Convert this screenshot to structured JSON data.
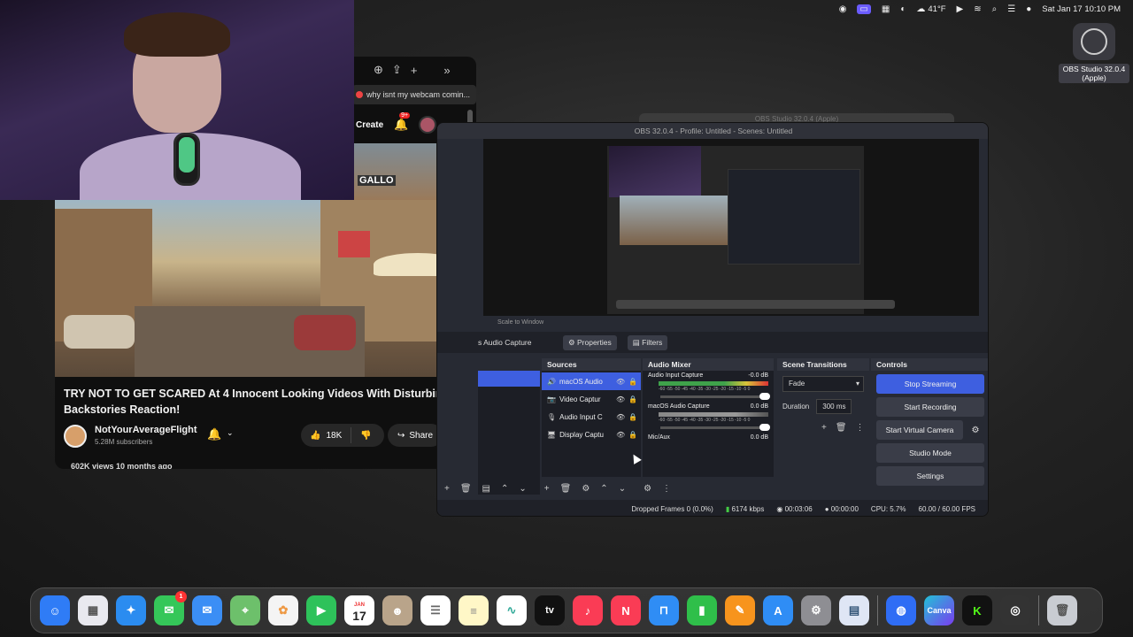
{
  "menubar": {
    "weather": "41°F",
    "clock": "Sat Jan 17  10:10 PM",
    "icons": [
      "stop-record-icon",
      "screen-mirror-icon",
      "gallery-icon",
      "creative-cloud-icon",
      "weather-icon",
      "play-icon",
      "wifi-icon",
      "search-icon",
      "control-center-icon",
      "siri-icon"
    ]
  },
  "desktop_icon": {
    "label": "OBS Studio 32.0.4 (Apple)"
  },
  "browser": {
    "tab_title": "why isnt my webcam comin...",
    "create_label": "Create",
    "notif_count": "9+",
    "overlay_text": "GALLO",
    "video_title": "TRY NOT TO GET SCARED At 4 Innocent Looking Videos With Disturbing Backstories Reaction!",
    "channel_name": "NotYourAverageFlight",
    "subscribers": "5.28M subscribers",
    "likes": "18K",
    "share_label": "Share",
    "views": "602K views  10 months ago"
  },
  "obs": {
    "back_title": "OBS Studio 32.0.4 (Apple)",
    "title": "OBS 32.0.4 - Profile: Untitled - Scenes: Untitled",
    "scale_label": "Scale to Window",
    "selected_source": "s Audio Capture",
    "properties_label": "Properties",
    "filters_label": "Filters",
    "docks": {
      "sources": "Sources",
      "mixer": "Audio Mixer",
      "transitions": "Scene Transitions",
      "controls": "Controls"
    },
    "sources": [
      {
        "name": "macOS Audio",
        "icon": "speaker-icon"
      },
      {
        "name": "Video Captur",
        "icon": "camera-icon"
      },
      {
        "name": "Audio Input C",
        "icon": "mic-icon"
      },
      {
        "name": "Display Captu",
        "icon": "monitor-icon"
      }
    ],
    "mixer": [
      {
        "name": "Audio Input Capture",
        "db": "-0.0 dB",
        "active": true
      },
      {
        "name": "macOS Audio Capture",
        "db": "0.0 dB",
        "active": false
      },
      {
        "name": "Mic/Aux",
        "db": "0.0 dB",
        "active": false
      }
    ],
    "meter_ticks": "-60 -55 -50 -45 -40 -35 -30 -25 -20 -15 -10 -5 0",
    "transition": "Fade",
    "duration_label": "Duration",
    "duration_value": "300 ms",
    "controls": {
      "stop_streaming": "Stop Streaming",
      "start_recording": "Start Recording",
      "virtual_camera": "Start Virtual Camera",
      "studio_mode": "Studio Mode",
      "settings": "Settings"
    },
    "status": {
      "dropped": "Dropped Frames 0 (0.0%)",
      "bitrate": "6174 kbps",
      "stream_time": "00:03:06",
      "rec_time": "00:00:00",
      "cpu": "CPU: 5.7%",
      "fps": "60.00 / 60.00 FPS"
    }
  },
  "dock": {
    "calendar_month": "JAN",
    "calendar_day": "17",
    "messages_badge": "1",
    "tv_label": "tv",
    "canva_label": "Canva",
    "apps": [
      "finder",
      "launchpad",
      "safari",
      "messages",
      "mail",
      "maps",
      "photos",
      "facetime",
      "calendar",
      "contacts",
      "reminders",
      "notes",
      "freeform",
      "tv",
      "music",
      "news",
      "keynote",
      "numbers",
      "pages",
      "app-store",
      "system-settings",
      "preview",
      "mouse-utility",
      "canva",
      "kick",
      "obs",
      "trash"
    ]
  }
}
